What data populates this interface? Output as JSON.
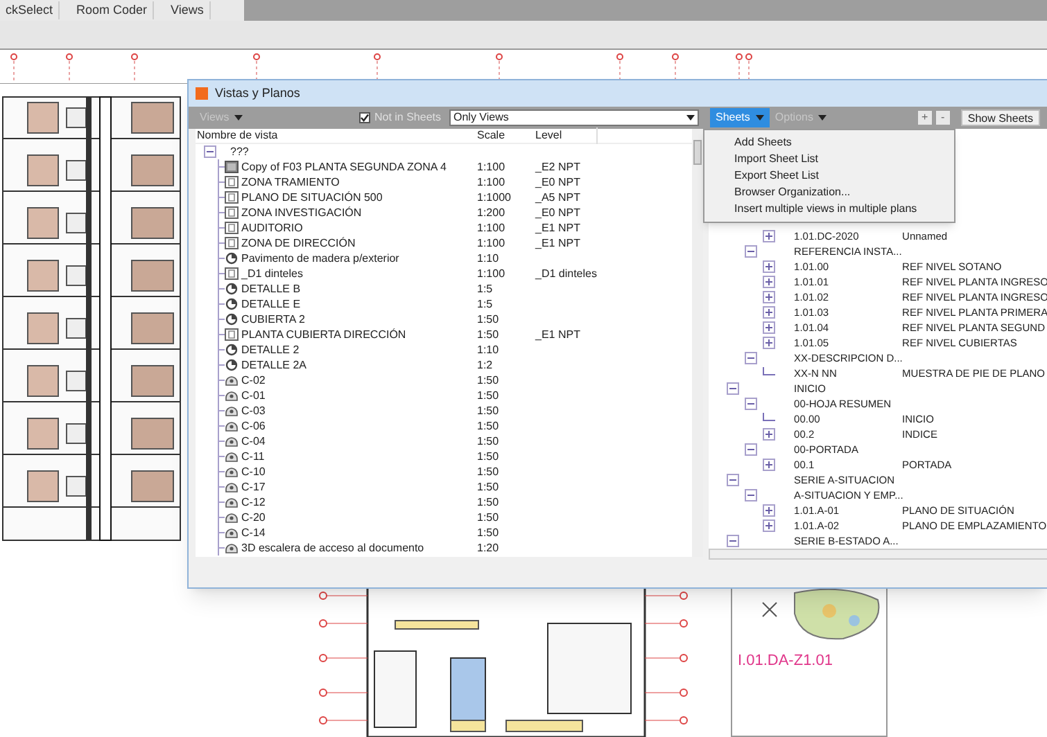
{
  "toolbar": {
    "tabs": [
      "ckSelect",
      "Room Coder",
      "Views"
    ]
  },
  "sheet_preview": {
    "number": "I.01.DA-Z1.01"
  },
  "dialog": {
    "title": "Vistas y Planos",
    "views_menu": {
      "label": "Views",
      "disabled": true
    },
    "not_in_sheets": {
      "label": "Not in Sheets",
      "checked": true
    },
    "filter": {
      "value": "Only Views"
    },
    "sheets_menu": {
      "label": "Sheets",
      "open": true
    },
    "options_menu": {
      "label": "Options",
      "disabled": true
    },
    "add_button": "+",
    "remove_button": "-",
    "show_sheets_button": "Show Sheets",
    "columns": [
      "Nombre de vista",
      "Scale",
      "Level"
    ],
    "view_tree": [
      {
        "name": "???",
        "expanded": true,
        "children": [
          {
            "kind": "copy",
            "name": "Copy of F03 PLANTA SEGUNDA ZONA 4",
            "scale": "1:100",
            "level": "_E2 NPT"
          },
          {
            "kind": "plan",
            "name": "ZONA TRAMIENTO",
            "scale": "1:100",
            "level": "_E0 NPT"
          },
          {
            "kind": "plan",
            "name": "PLANO DE SITUACIÓN 500",
            "scale": "1:1000",
            "level": "_A5 NPT"
          },
          {
            "kind": "plan",
            "name": "ZONA INVESTIGACIÓN",
            "scale": "1:200",
            "level": "_E0 NPT"
          },
          {
            "kind": "plan",
            "name": "AUDITORIO",
            "scale": "1:100",
            "level": "_E1 NPT"
          },
          {
            "kind": "plan",
            "name": "ZONA DE DIRECCIÓN",
            "scale": "1:100",
            "level": "_E1 NPT"
          },
          {
            "kind": "detail",
            "name": "Pavimento de madera p/exterior",
            "scale": "1:10"
          },
          {
            "kind": "plan",
            "name": "_D1 dinteles",
            "scale": "1:100",
            "level": "_D1 dinteles"
          },
          {
            "kind": "detail",
            "name": "DETALLE B",
            "scale": "1:5"
          },
          {
            "kind": "detail",
            "name": "DETALLE E",
            "scale": "1:5"
          },
          {
            "kind": "detail",
            "name": "CUBIERTA 2",
            "scale": "1:50"
          },
          {
            "kind": "plan",
            "name": "PLANTA CUBIERTA DIRECCIÓN",
            "scale": "1:50",
            "level": "_E1 NPT"
          },
          {
            "kind": "detail",
            "name": "DETALLE 2",
            "scale": "1:10"
          },
          {
            "kind": "detail",
            "name": "DETALLE 2A",
            "scale": "1:2"
          },
          {
            "kind": "elevation",
            "name": "C-02",
            "scale": "1:50"
          },
          {
            "kind": "elevation",
            "name": "C-01",
            "scale": "1:50"
          },
          {
            "kind": "elevation",
            "name": "C-03",
            "scale": "1:50"
          },
          {
            "kind": "elevation",
            "name": "C-06",
            "scale": "1:50"
          },
          {
            "kind": "elevation",
            "name": "C-04",
            "scale": "1:50"
          },
          {
            "kind": "elevation",
            "name": "C-11",
            "scale": "1:50"
          },
          {
            "kind": "elevation",
            "name": "C-10",
            "scale": "1:50"
          },
          {
            "kind": "elevation",
            "name": "C-17",
            "scale": "1:50"
          },
          {
            "kind": "elevation",
            "name": "C-12",
            "scale": "1:50"
          },
          {
            "kind": "elevation",
            "name": "C-20",
            "scale": "1:50"
          },
          {
            "kind": "elevation",
            "name": "C-14",
            "scale": "1:50"
          },
          {
            "kind": "elevation",
            "name": "3D escalera de acceso al documento",
            "scale": "1:20"
          }
        ]
      }
    ],
    "sheets_dropdown": [
      "Add Sheets",
      "Import Sheet List",
      "Export Sheet List",
      "Browser Organization...",
      "Insert multiple views in multiple plans"
    ],
    "sheet_tree": [
      {
        "children": [
          {
            "children": [
              {
                "kind": "node",
                "code": "1.01.DC-2020",
                "title": "Unnamed",
                "expanded": false
              }
            ]
          },
          {
            "kind": "node",
            "code": "REFERENCIA INSTA...",
            "expanded": true,
            "children": [
              {
                "kind": "node",
                "code": "1.01.00",
                "title": "REF NIVEL SOTANO",
                "expanded": false
              },
              {
                "kind": "node",
                "code": "1.01.01",
                "title": "REF NIVEL PLANTA INGRESO",
                "expanded": false
              },
              {
                "kind": "node",
                "code": "1.01.02",
                "title": "REF NIVEL PLANTA INGRESO",
                "expanded": false
              },
              {
                "kind": "node",
                "code": "1.01.03",
                "title": "REF NIVEL PLANTA PRIMERA",
                "expanded": false
              },
              {
                "kind": "node",
                "code": "1.01.04",
                "title": "REF NIVEL PLANTA SEGUND",
                "expanded": false
              },
              {
                "kind": "node",
                "code": "1.01.05",
                "title": "REF NIVEL CUBIERTAS",
                "expanded": false
              }
            ]
          },
          {
            "kind": "node",
            "code": "XX-DESCRIPCION D...",
            "expanded": true,
            "children": [
              {
                "kind": "leaf",
                "code": "XX-N NN",
                "title": "MUESTRA DE PIE DE PLANO"
              }
            ]
          }
        ]
      },
      {
        "kind": "node",
        "code": "INICIO",
        "expanded": true,
        "children": [
          {
            "kind": "node",
            "code": "00-HOJA RESUMEN",
            "expanded": true,
            "children": [
              {
                "kind": "leaf",
                "code": "00.00",
                "title": "INICIO"
              },
              {
                "kind": "node",
                "code": "00.2",
                "title": "INDICE",
                "expanded": false
              }
            ]
          },
          {
            "kind": "node",
            "code": "00-PORTADA",
            "expanded": true,
            "children": [
              {
                "kind": "node",
                "code": "00.1",
                "title": "PORTADA",
                "expanded": false
              }
            ]
          }
        ]
      },
      {
        "kind": "node",
        "code": "SERIE A-SITUACION",
        "expanded": true,
        "children": [
          {
            "kind": "node",
            "code": "A-SITUACION Y EMP...",
            "expanded": true,
            "children": [
              {
                "kind": "node",
                "code": "1.01.A-01",
                "title": "PLANO DE SITUACIÓN",
                "expanded": false
              },
              {
                "kind": "node",
                "code": "1.01.A-02",
                "title": "PLANO DE EMPLAZAMIENTO",
                "expanded": false
              }
            ]
          }
        ]
      },
      {
        "kind": "node",
        "code": "SERIE B-ESTADO A...",
        "expanded": true
      }
    ]
  }
}
